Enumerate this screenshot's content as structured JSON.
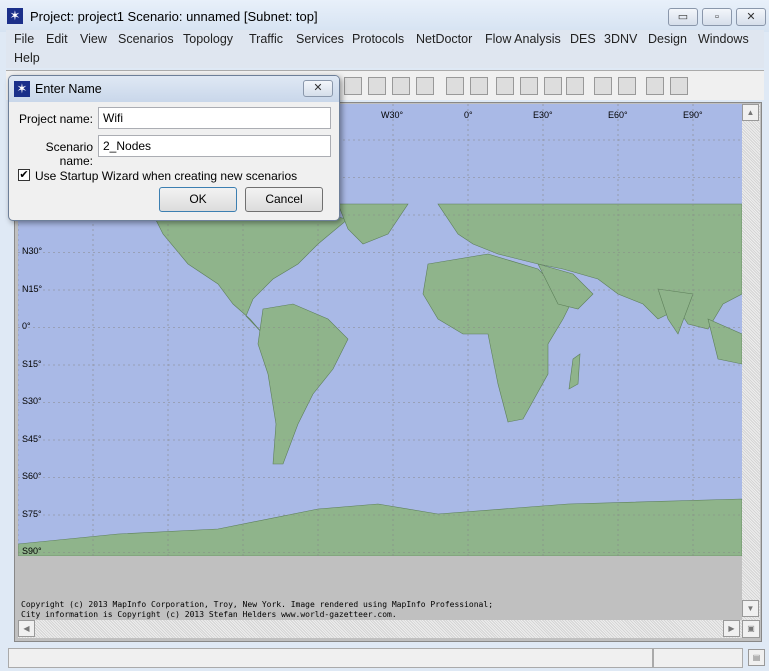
{
  "window": {
    "title": "Project: project1 Scenario: unnamed  [Subnet: top]",
    "minimize": "▭",
    "maximize": "▫",
    "close": "✕"
  },
  "menu": [
    "File",
    "Edit",
    "View",
    "Scenarios",
    "Topology",
    "Traffic",
    "Services",
    "Protocols",
    "NetDoctor",
    "Flow Analysis",
    "DES",
    "3DNV",
    "Design",
    "Windows",
    "Help"
  ],
  "map": {
    "ocean_color": "#a9b9e6",
    "land_color": "#8fb48b",
    "lat_labels": [
      "N30°",
      "N15°",
      "0°",
      "S15°",
      "S30°",
      "S45°",
      "S60°",
      "S75°",
      "S90°"
    ],
    "lon_labels": [
      "W30°",
      "0°",
      "E30°",
      "E60°",
      "E90°"
    ],
    "copyright": [
      "Copyright (c) 2013 MapInfo Corporation, Troy, New York. Image rendered using MapInfo Professional;",
      "City information is Copyright (c) 2013 Stefan Helders www.world-gazetteer.com."
    ]
  },
  "dialog": {
    "title": "Enter Name",
    "close": "✕",
    "project_label": "Project name:",
    "project_value": "Wifi",
    "scenario_label": "Scenario name:",
    "scenario_value": "2_Nodes",
    "wizard_label": "Use Startup Wizard when creating new scenarios",
    "wizard_checked": true,
    "ok": "OK",
    "cancel": "Cancel"
  }
}
